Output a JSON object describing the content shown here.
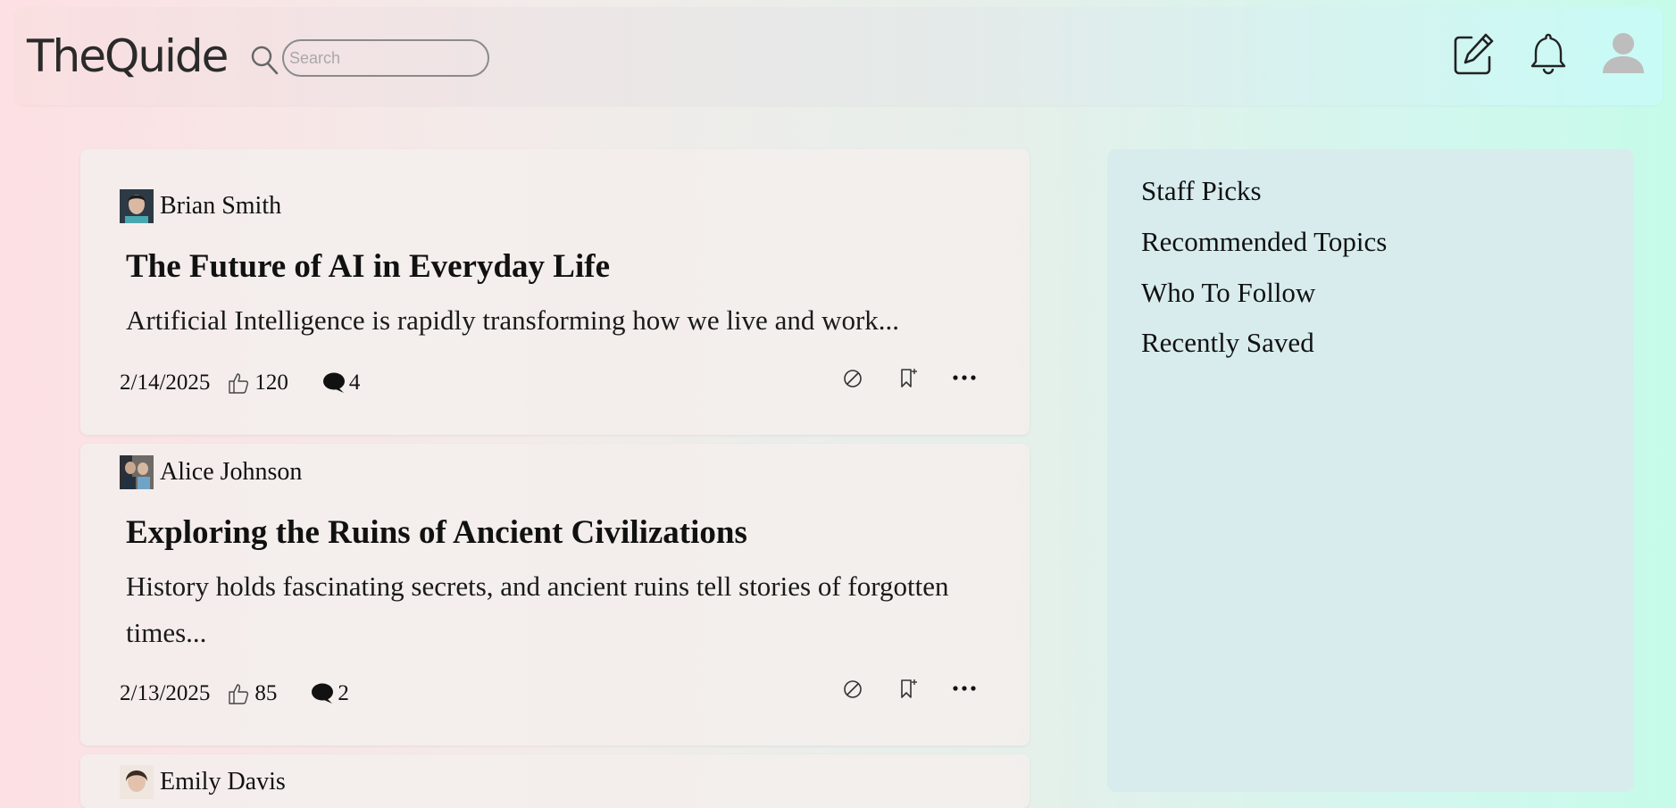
{
  "header": {
    "logo": "TheQuide",
    "search": {
      "placeholder": "Search",
      "value": ""
    },
    "icons": [
      "write-icon",
      "bell-icon",
      "user-avatar-icon"
    ]
  },
  "posts": [
    {
      "author": "Brian Smith",
      "title": "The Future of AI in Everyday Life",
      "excerpt": "Artificial Intelligence is rapidly transforming how we live and work...",
      "date": "2/14/2025",
      "likes": "120",
      "comments": "4"
    },
    {
      "author": "Alice Johnson",
      "title": "Exploring the Ruins of Ancient Civilizations",
      "excerpt": "History holds fascinating secrets, and ancient ruins tell stories of forgotten times...",
      "date": "2/13/2025",
      "likes": "85",
      "comments": "2"
    },
    {
      "author": "Emily Davis"
    }
  ],
  "sidebar": {
    "items": [
      {
        "label": "Staff Picks"
      },
      {
        "label": "Recommended Topics"
      },
      {
        "label": "Who To Follow"
      },
      {
        "label": "Recently Saved"
      }
    ]
  },
  "colors": {
    "sidebar_bg": "#d8ecee",
    "card_bg": "#f3eeec",
    "text": "#111111"
  }
}
